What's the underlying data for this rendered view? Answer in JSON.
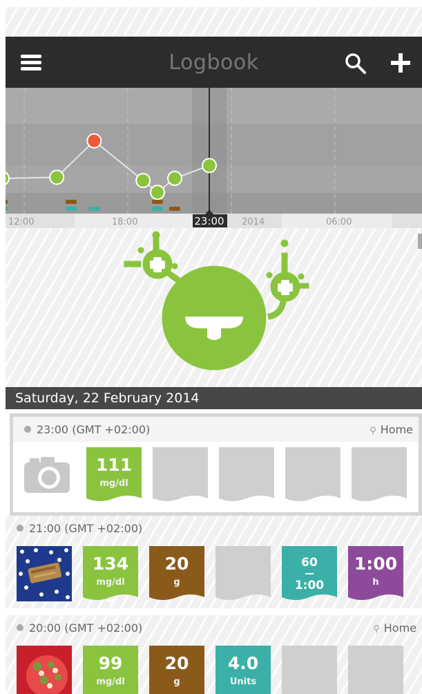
{
  "header": {
    "title": "Logbook",
    "menu_icon": "hamburger-menu-icon",
    "search_icon": "search-icon",
    "add_icon": "plus-icon"
  },
  "chart_data": {
    "type": "scatter",
    "x_ticks": [
      "12:00",
      "18:00",
      "23:00",
      "2014",
      "06:00"
    ],
    "selected_time": "23:00",
    "series": [
      {
        "values": [
          {
            "x": "11:00",
            "y": 99
          },
          {
            "x": "14:10",
            "y": 100
          },
          {
            "x": "16:20",
            "y": 134
          },
          {
            "x": "19:10",
            "y": 97
          },
          {
            "x": "20:00",
            "y": 86
          },
          {
            "x": "21:00",
            "y": 99
          },
          {
            "x": "23:00",
            "y": 111
          }
        ]
      }
    ],
    "colors": {
      "normal": "#8ac43f",
      "high": "#ef5a36",
      "carbs": "#8a5a1a",
      "insulin": "#3ab0a8"
    }
  },
  "date_header": "Saturday, 22 February 2014",
  "entries": [
    {
      "time": "23:00 (GMT +02:00)",
      "location": "Home",
      "glucose": {
        "value": "111",
        "unit": "mg/dl"
      }
    },
    {
      "time": "21:00 (GMT +02:00)",
      "location": "",
      "glucose": {
        "value": "134",
        "unit": "mg/dl"
      },
      "carbs": {
        "value": "20",
        "unit": "g"
      },
      "rate": {
        "top": "60",
        "bottom": "1:00"
      },
      "duration": {
        "value": "1:00",
        "unit": "h"
      }
    },
    {
      "time": "20:00 (GMT +02:00)",
      "location": "Home",
      "glucose": {
        "value": "99",
        "unit": "mg/dl"
      },
      "carbs": {
        "value": "20",
        "unit": "g"
      },
      "insulin": {
        "value": "4.0",
        "unit": "Units"
      }
    }
  ],
  "colors": {
    "header_bg": "#2c2c2c",
    "glucose": "#8ac43f",
    "carbs": "#8a5a1a",
    "insulin": "#3ab0a8",
    "activity": "#8e4a9a",
    "empty": "#cfcfcf"
  }
}
